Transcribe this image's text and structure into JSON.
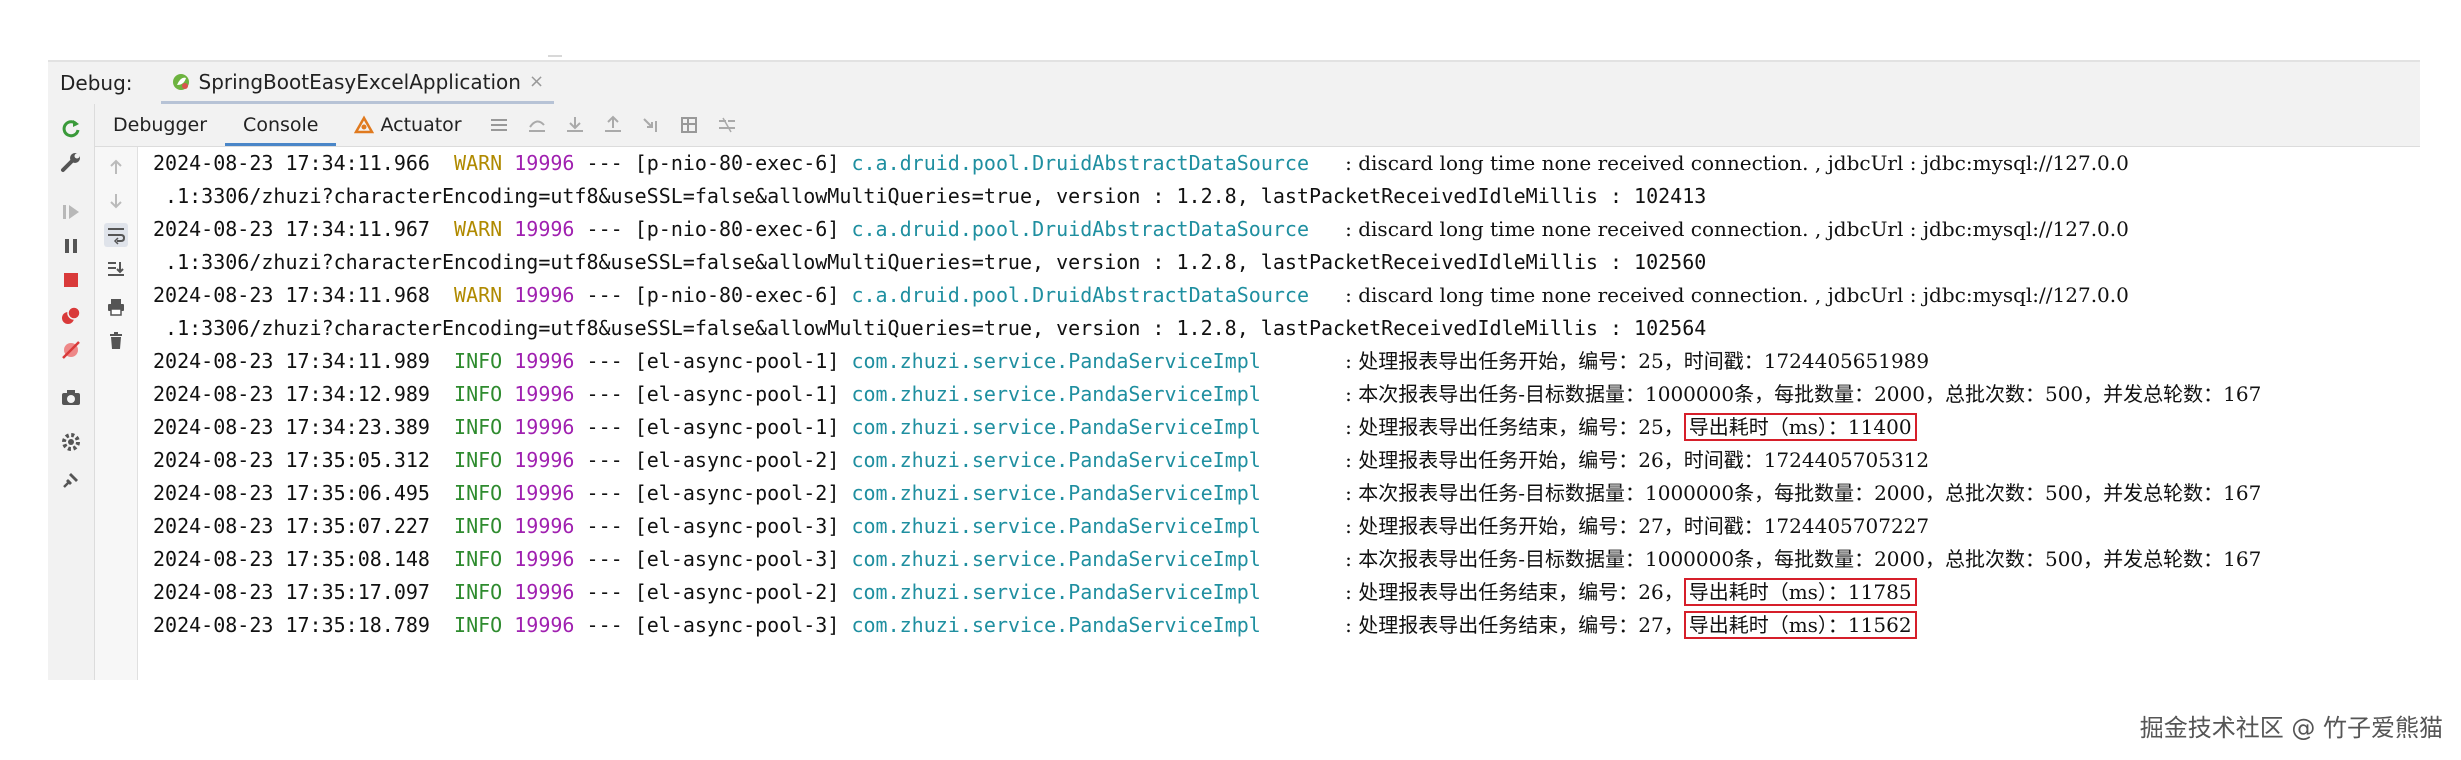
{
  "debug_bar": {
    "label": "Debug:",
    "run_config": "SpringBootEasyExcelApplication",
    "close_glyph": "×"
  },
  "tabs": [
    {
      "label": "Debugger"
    },
    {
      "label": "Console"
    },
    {
      "label": "Actuator"
    }
  ],
  "active_tab": "Console",
  "icons": {
    "left_toolbar": [
      "rerun-icon",
      "settings-wrench-icon",
      "resume-icon",
      "pause-icon",
      "stop-icon",
      "view-breakpoints-icon",
      "mute-breakpoints-icon",
      "camera-icon",
      "gear-icon",
      "pin-icon"
    ],
    "tabs_row": [
      "list-icon",
      "step-over-icon",
      "step-into-icon",
      "step-out-icon",
      "run-to-cursor-icon",
      "evaluate-icon",
      "trace-icon"
    ],
    "gutter": [
      "scroll-up-icon",
      "scroll-down-icon",
      "soft-wrap-icon",
      "scroll-to-end-icon",
      "print-icon",
      "trash-icon"
    ]
  },
  "colors": {
    "warn": "#b08a00",
    "info": "#2e8b2e",
    "pid": "#a020b0",
    "logger": "#1f8fa0",
    "highlight_box": "#d61f2a"
  },
  "console": {
    "lines": [
      {
        "ts": "2024-08-23 17:34:11.966",
        "level": "WARN",
        "pid": "19996",
        "thread": "--- [p-nio-80-exec-6]",
        "logger": "c.a.druid.pool.DruidAbstractDataSource",
        "pad": "   ",
        "msg": ": discard long time none received connection. , jdbcUrl : jdbc:mysql://127.0.0"
      },
      {
        "cont": " .1:3306/zhuzi?characterEncoding=utf8&useSSL=false&allowMultiQueries=true, version : 1.2.8, lastPacketReceivedIdleMillis : 102413"
      },
      {
        "ts": "2024-08-23 17:34:11.967",
        "level": "WARN",
        "pid": "19996",
        "thread": "--- [p-nio-80-exec-6]",
        "logger": "c.a.druid.pool.DruidAbstractDataSource",
        "pad": "   ",
        "msg": ": discard long time none received connection. , jdbcUrl : jdbc:mysql://127.0.0"
      },
      {
        "cont": " .1:3306/zhuzi?characterEncoding=utf8&useSSL=false&allowMultiQueries=true, version : 1.2.8, lastPacketReceivedIdleMillis : 102560"
      },
      {
        "ts": "2024-08-23 17:34:11.968",
        "level": "WARN",
        "pid": "19996",
        "thread": "--- [p-nio-80-exec-6]",
        "logger": "c.a.druid.pool.DruidAbstractDataSource",
        "pad": "   ",
        "msg": ": discard long time none received connection. , jdbcUrl : jdbc:mysql://127.0.0"
      },
      {
        "cont": " .1:3306/zhuzi?characterEncoding=utf8&useSSL=false&allowMultiQueries=true, version : 1.2.8, lastPacketReceivedIdleMillis : 102564"
      },
      {
        "ts": "2024-08-23 17:34:11.989",
        "level": "INFO",
        "pid": "19996",
        "thread": "--- [el-async-pool-1]",
        "logger": "com.zhuzi.service.PandaServiceImpl",
        "pad": "       ",
        "msg": ": 处理报表导出任务开始，编号：25，时间戳：1724405651989"
      },
      {
        "ts": "2024-08-23 17:34:12.989",
        "level": "INFO",
        "pid": "19996",
        "thread": "--- [el-async-pool-1]",
        "logger": "com.zhuzi.service.PandaServiceImpl",
        "pad": "       ",
        "msg": ": 本次报表导出任务-目标数据量：1000000条，每批数量：2000，总批次数：500，并发总轮数：167"
      },
      {
        "ts": "2024-08-23 17:34:23.389",
        "level": "INFO",
        "pid": "19996",
        "thread": "--- [el-async-pool-1]",
        "logger": "com.zhuzi.service.PandaServiceImpl",
        "pad": "       ",
        "msg": ": 处理报表导出任务结束，编号：25，",
        "hl": "导出耗时（ms）：11400"
      },
      {
        "ts": "2024-08-23 17:35:05.312",
        "level": "INFO",
        "pid": "19996",
        "thread": "--- [el-async-pool-2]",
        "logger": "com.zhuzi.service.PandaServiceImpl",
        "pad": "       ",
        "msg": ": 处理报表导出任务开始，编号：26，时间戳：1724405705312"
      },
      {
        "ts": "2024-08-23 17:35:06.495",
        "level": "INFO",
        "pid": "19996",
        "thread": "--- [el-async-pool-2]",
        "logger": "com.zhuzi.service.PandaServiceImpl",
        "pad": "       ",
        "msg": ": 本次报表导出任务-目标数据量：1000000条，每批数量：2000，总批次数：500，并发总轮数：167"
      },
      {
        "ts": "2024-08-23 17:35:07.227",
        "level": "INFO",
        "pid": "19996",
        "thread": "--- [el-async-pool-3]",
        "logger": "com.zhuzi.service.PandaServiceImpl",
        "pad": "       ",
        "msg": ": 处理报表导出任务开始，编号：27，时间戳：1724405707227"
      },
      {
        "ts": "2024-08-23 17:35:08.148",
        "level": "INFO",
        "pid": "19996",
        "thread": "--- [el-async-pool-3]",
        "logger": "com.zhuzi.service.PandaServiceImpl",
        "pad": "       ",
        "msg": ": 本次报表导出任务-目标数据量：1000000条，每批数量：2000，总批次数：500，并发总轮数：167"
      },
      {
        "ts": "2024-08-23 17:35:17.097",
        "level": "INFO",
        "pid": "19996",
        "thread": "--- [el-async-pool-2]",
        "logger": "com.zhuzi.service.PandaServiceImpl",
        "pad": "       ",
        "msg": ": 处理报表导出任务结束，编号：26，",
        "hl": "导出耗时（ms）：11785"
      },
      {
        "ts": "2024-08-23 17:35:18.789",
        "level": "INFO",
        "pid": "19996",
        "thread": "--- [el-async-pool-3]",
        "logger": "com.zhuzi.service.PandaServiceImpl",
        "pad": "       ",
        "msg": ": 处理报表导出任务结束，编号：27，",
        "hl": "导出耗时（ms）：11562"
      }
    ]
  },
  "watermark": "掘金技术社区 @ 竹子爱熊猫"
}
